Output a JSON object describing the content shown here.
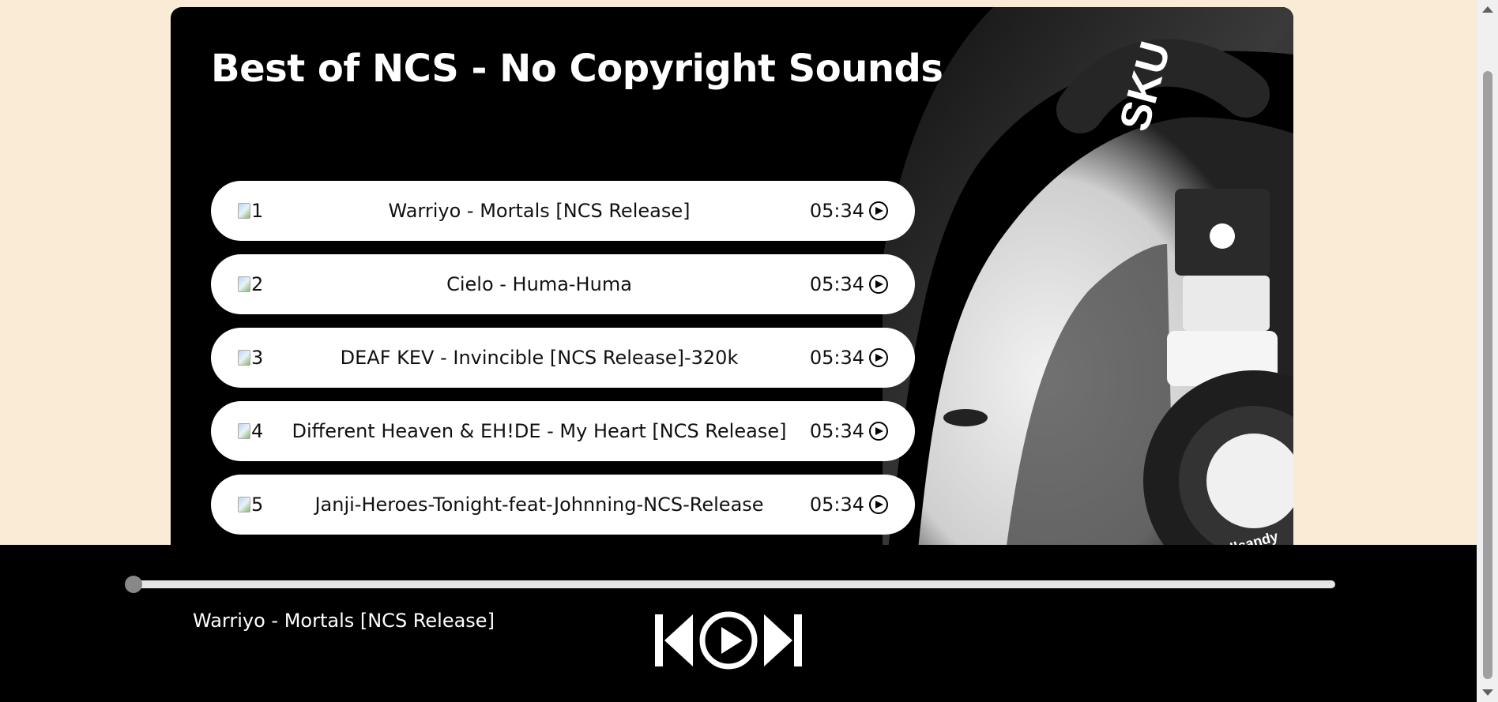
{
  "page_title": "Best of NCS - No Copyright Sounds",
  "songs": [
    {
      "index": "1",
      "name": "Warriyo - Mortals [NCS Release]",
      "time": "05:34"
    },
    {
      "index": "2",
      "name": "Cielo - Huma-Huma",
      "time": "05:34"
    },
    {
      "index": "3",
      "name": "DEAF KEV - Invincible [NCS Release]-320k",
      "time": "05:34"
    },
    {
      "index": "4",
      "name": "Different Heaven & EH!DE - My Heart [NCS Release]",
      "time": "05:34"
    },
    {
      "index": "5",
      "name": "Janji-Heroes-Tonight-feat-Johnning-NCS-Release",
      "time": "05:34"
    }
  ],
  "player": {
    "now_playing": "Warriyo - Mortals [NCS Release]",
    "progress": 0
  },
  "cover_art": {
    "brand_text": "Skullcandy",
    "headband_text": "SKU"
  },
  "colors": {
    "page_bg": "#faebd7",
    "panel_bg": "#000000",
    "item_bg": "#ffffff"
  }
}
